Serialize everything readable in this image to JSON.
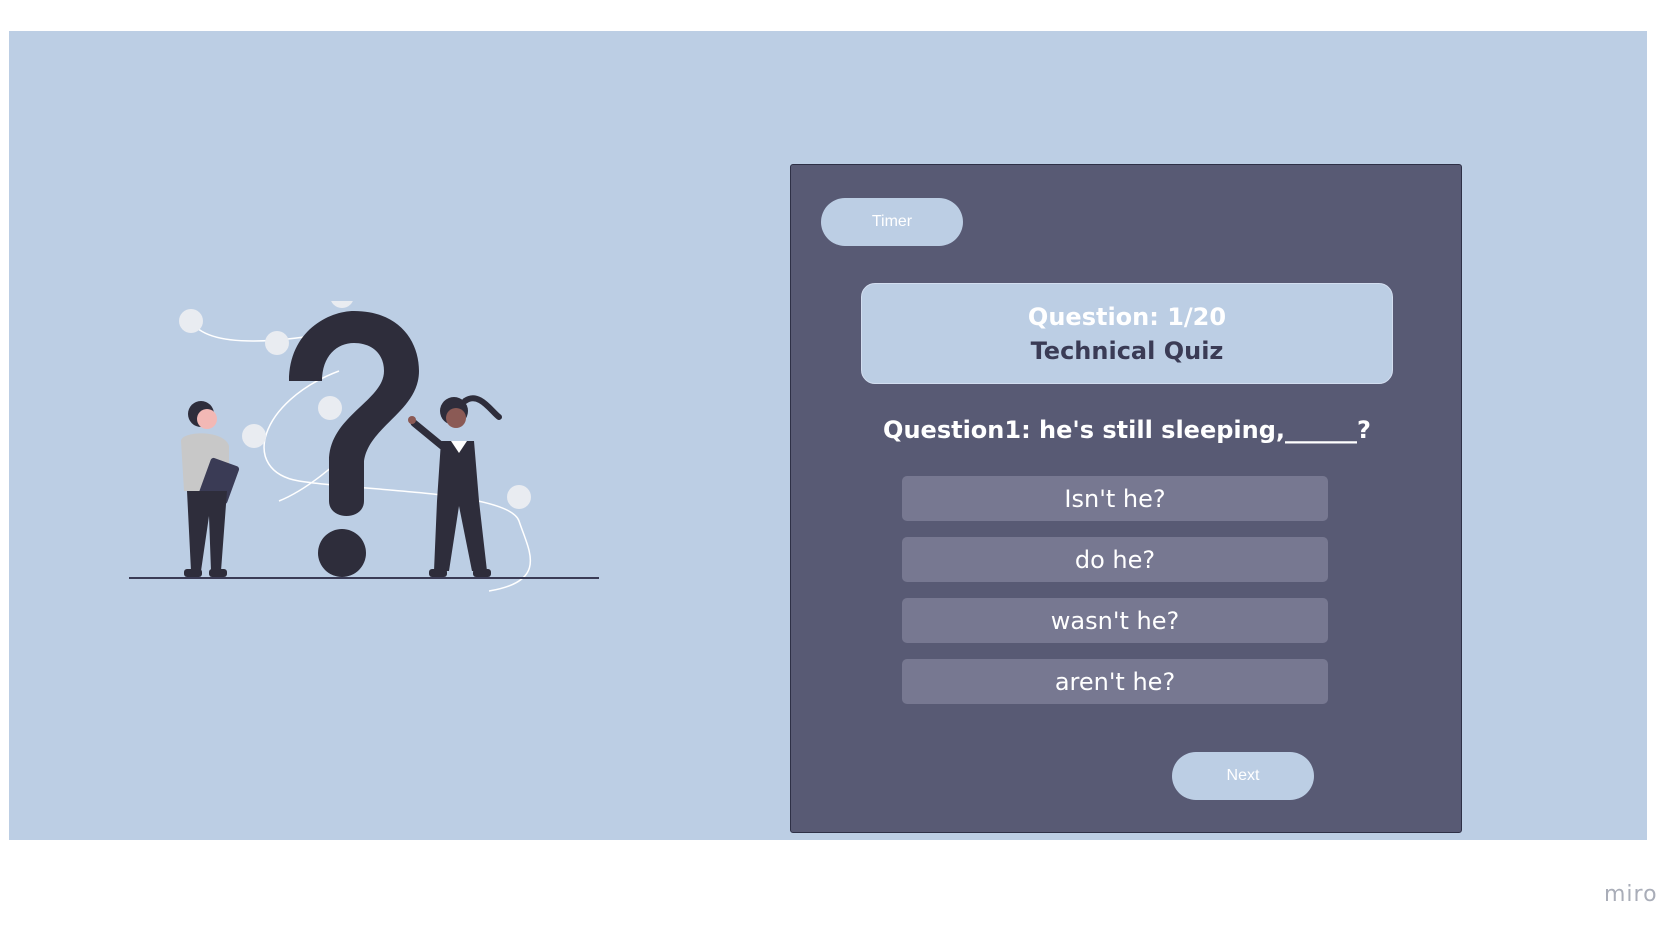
{
  "timer": {
    "label": "Timer"
  },
  "header": {
    "counter": "Question: 1/20",
    "title": "Technical Quiz"
  },
  "question": {
    "text": "Question1: he's still sleeping,______?"
  },
  "options": [
    {
      "label": "Isn't he?"
    },
    {
      "label": "do he?"
    },
    {
      "label": "wasn't he?"
    },
    {
      "label": "aren't he?"
    }
  ],
  "next": {
    "label": "Next"
  },
  "brand": {
    "label": "miro"
  },
  "colors": {
    "background": "#bccee4",
    "card": "#585a74",
    "option": "#777891",
    "title_text": "#3a3b55"
  }
}
